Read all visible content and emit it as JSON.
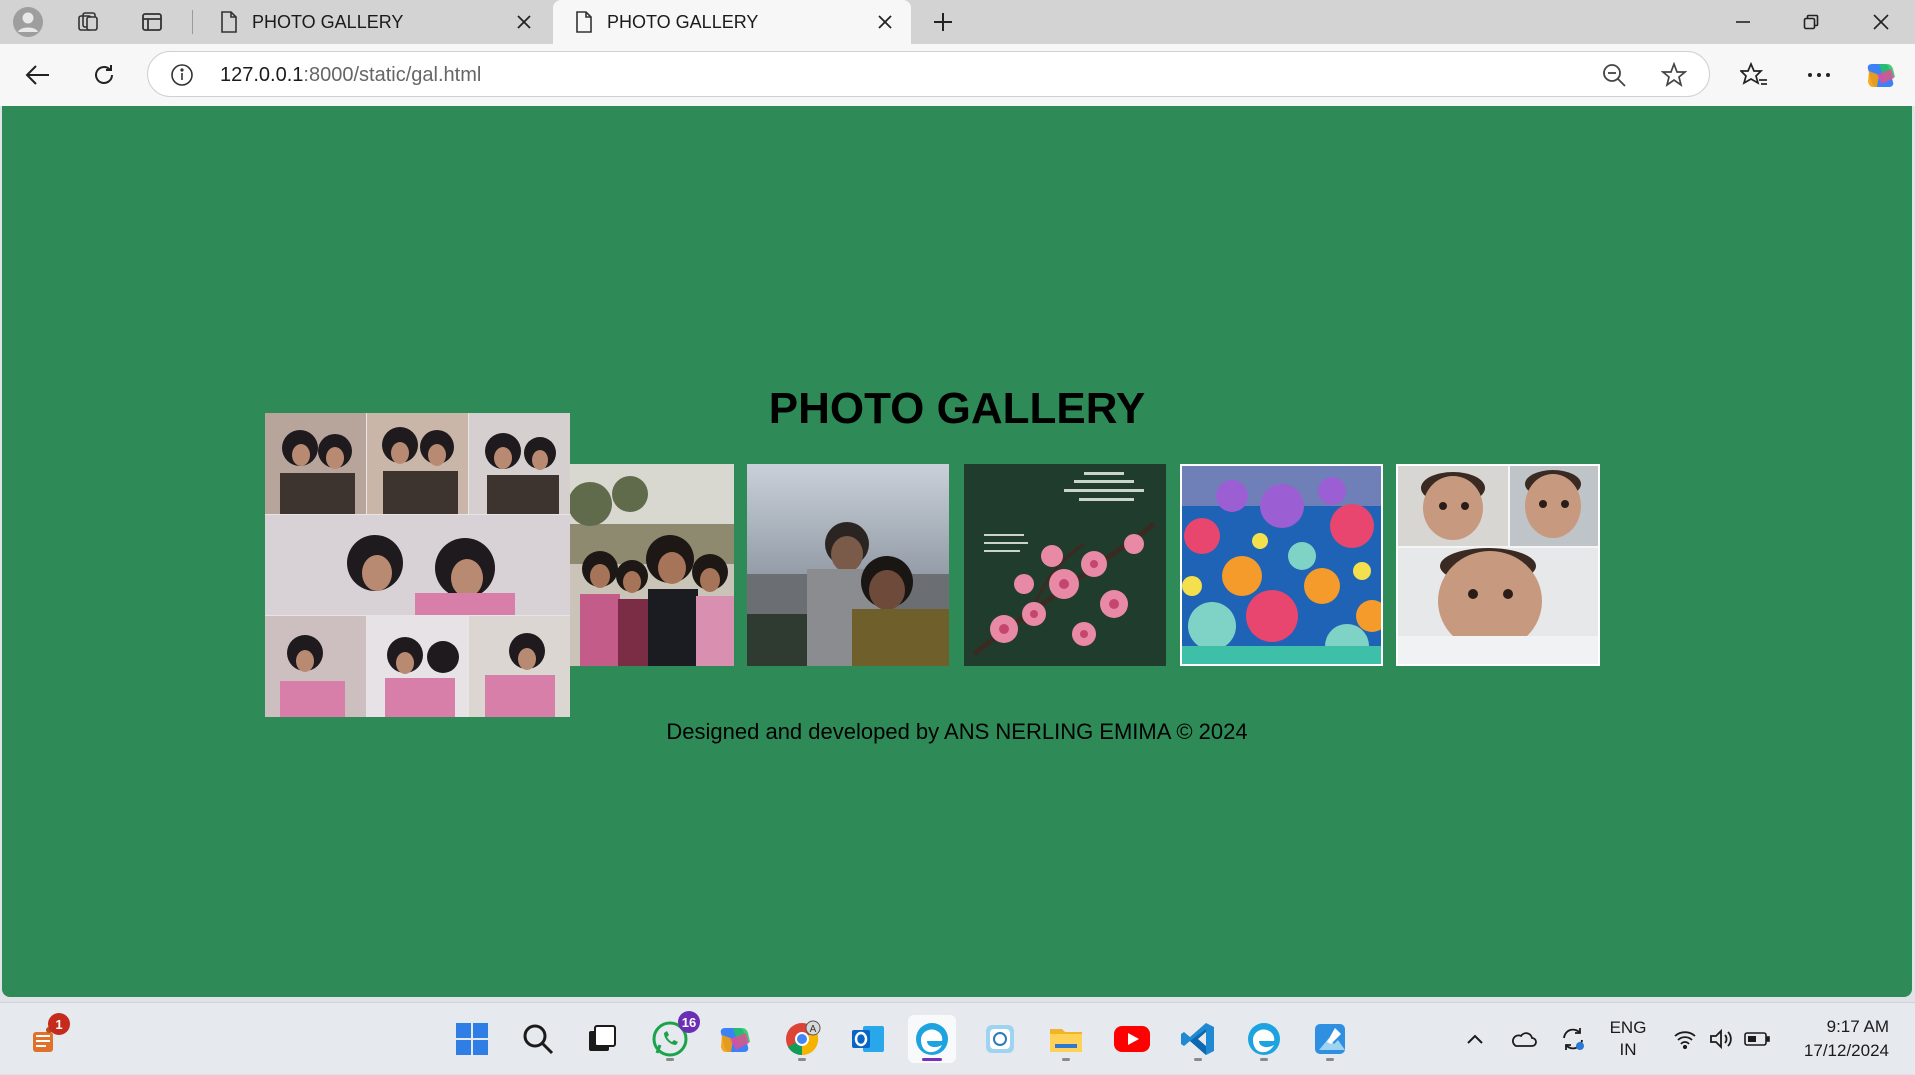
{
  "browser": {
    "tabs": [
      {
        "title": "PHOTO GALLERY",
        "active": false
      },
      {
        "title": "PHOTO GALLERY",
        "active": true
      }
    ],
    "url_host": "127.0.0.1",
    "url_rest": ":8000/static/gal.html"
  },
  "page": {
    "background": "#2e8b57",
    "title": "PHOTO GALLERY",
    "photos": [
      {
        "name": "friends-collage",
        "scene": "people"
      },
      {
        "name": "group-selfie",
        "scene": "people"
      },
      {
        "name": "couple-at-sea",
        "scene": "beach"
      },
      {
        "name": "pink-blossom-verse",
        "scene": "flowers"
      },
      {
        "name": "coral-reef",
        "scene": "ocean"
      },
      {
        "name": "baby-collage",
        "scene": "baby"
      }
    ],
    "footer": "Designed and developed by ANS NERLING EMIMA © 2024"
  },
  "taskbar": {
    "widget_badge": "1",
    "whatsapp_badge": "16",
    "apps": [
      "start-icon",
      "search-icon",
      "task-view-icon",
      "whatsapp-icon",
      "copilot-icon",
      "chrome-icon",
      "outlook-icon",
      "edge-icon",
      "photos-app-icon",
      "file-explorer-icon",
      "youtube-icon",
      "vscode-icon",
      "edge-icon",
      "paint-icon"
    ],
    "language_line1": "ENG",
    "language_line2": "IN",
    "time": "9:17 AM",
    "date": "17/12/2024"
  }
}
